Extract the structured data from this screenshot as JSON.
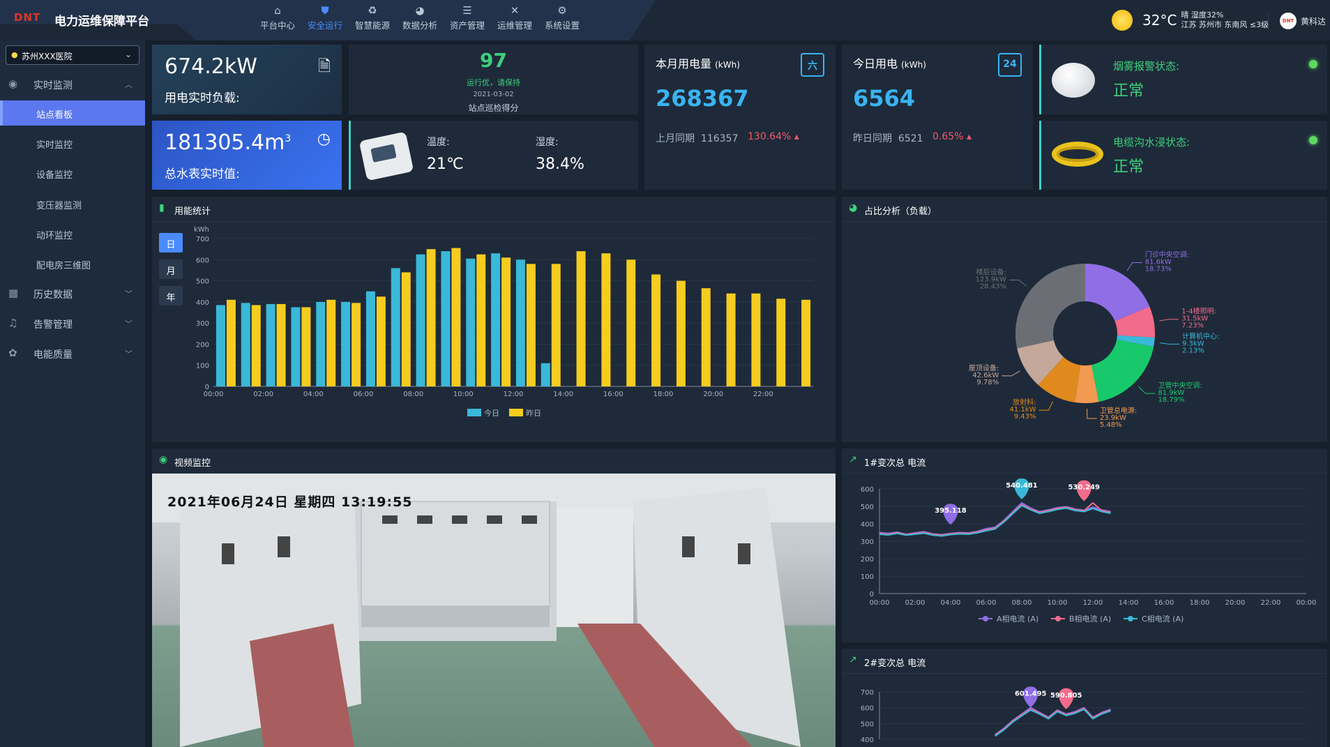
{
  "header": {
    "logo": "DNT",
    "title": "电力运维保障平台",
    "nav": [
      {
        "label": "平台中心",
        "icon": "home-icon"
      },
      {
        "label": "安全运行",
        "icon": "shield-icon"
      },
      {
        "label": "智慧能源",
        "icon": "recycle-icon"
      },
      {
        "label": "数据分析",
        "icon": "pie-icon"
      },
      {
        "label": "资产管理",
        "icon": "database-icon"
      },
      {
        "label": "运维管理",
        "icon": "tools-icon"
      },
      {
        "label": "系统设置",
        "icon": "gear-icon"
      }
    ],
    "active_nav": "安全运行",
    "weather": {
      "temp": "32°C",
      "line1": "晴 湿度32%",
      "line2": "江苏 苏州市 东南风 ≤3级"
    },
    "user": "黄科达"
  },
  "sidebar": {
    "site": "苏州XXX医院",
    "groups": [
      {
        "label": "实时监测",
        "icon": "monitor-icon",
        "expanded": true,
        "items": [
          "站点看板",
          "实时监控",
          "设备监控",
          "变压器监测",
          "动环监控",
          "配电房三维图"
        ],
        "active": "站点看板"
      },
      {
        "label": "历史数据",
        "icon": "calendar-icon"
      },
      {
        "label": "告警管理",
        "icon": "bell-icon"
      },
      {
        "label": "电能质量",
        "icon": "quality-icon"
      }
    ]
  },
  "cards": {
    "load": {
      "value": "674.2kW",
      "label": "用电实时负载:"
    },
    "water": {
      "value": "181305.4m",
      "sup": "3",
      "label": "总水表实时值:"
    },
    "score": {
      "value": "97",
      "status": "运行优，请保持",
      "date": "2021-03-02",
      "label": "站点巡检得分"
    },
    "env": {
      "temp_label": "温度:",
      "temp": "21℃",
      "hum_label": "湿度:",
      "hum": "38.4%"
    },
    "month": {
      "title": "本月用电量",
      "unit": "(kWh)",
      "value": "268367",
      "cmp_label": "上月同期",
      "cmp_value": "116357",
      "pct": "130.64%",
      "icon_text": "六"
    },
    "today": {
      "title": "今日用电",
      "unit": "(kWh)",
      "value": "6564",
      "cmp_label": "昨日同期",
      "cmp_value": "6521",
      "pct": "0.65%",
      "icon_text": "24"
    },
    "smoke": {
      "title": "烟雾报警状态:",
      "value": "正常"
    },
    "cable": {
      "title": "电缆沟水浸状态:",
      "value": "正常"
    }
  },
  "energy_panel": {
    "title": "用能统计",
    "periods": [
      "日",
      "月",
      "年"
    ],
    "active": "日"
  },
  "ratio_panel": {
    "title": "占比分析（负载）"
  },
  "video_panel": {
    "title": "视频监控",
    "osd": "2021年06月24日  星期四  13:19:55"
  },
  "cur1_panel": {
    "title": "1#变次总 电流"
  },
  "cur2_panel": {
    "title": "2#变次总 电流"
  },
  "chart_data": [
    {
      "type": "bar",
      "title": "用能统计",
      "ylabel": "kWh",
      "ylim": [
        0,
        700
      ],
      "yticks": [
        0,
        100,
        200,
        300,
        400,
        500,
        600,
        700
      ],
      "x_tick_labels": [
        "00:00",
        "02:00",
        "04:00",
        "06:00",
        "08:00",
        "10:00",
        "12:00",
        "14:00",
        "16:00",
        "18:00",
        "20:00",
        "22:00"
      ],
      "categories": [
        "00",
        "01",
        "02",
        "03",
        "04",
        "05",
        "06",
        "07",
        "08",
        "09",
        "10",
        "11",
        "12",
        "13",
        "14",
        "15",
        "16",
        "17",
        "18",
        "19",
        "20",
        "21",
        "22",
        "23"
      ],
      "series": [
        {
          "name": "今日",
          "color": "#3ab8d8",
          "values": [
            385,
            395,
            390,
            375,
            400,
            400,
            450,
            560,
            625,
            640,
            605,
            630,
            600,
            110,
            null,
            null,
            null,
            null,
            null,
            null,
            null,
            null,
            null,
            null
          ]
        },
        {
          "name": "昨日",
          "color": "#f5cc1f",
          "values": [
            410,
            385,
            390,
            375,
            410,
            395,
            425,
            540,
            650,
            655,
            625,
            610,
            580,
            580,
            640,
            630,
            600,
            530,
            500,
            465,
            440,
            440,
            415,
            410
          ]
        }
      ],
      "legend": "bottom"
    },
    {
      "type": "pie",
      "title": "占比分析（负载）",
      "donut": true,
      "slices": [
        {
          "name": "门诊中央空调",
          "value": 81.6,
          "unit": "kW",
          "pct": "18.73%",
          "color": "#8f6ee6"
        },
        {
          "name": "1-4楼照明",
          "value": 31.5,
          "unit": "kW",
          "pct": "7.23%",
          "color": "#f26b8a"
        },
        {
          "name": "计算机中心",
          "value": 9.3,
          "unit": "kW",
          "pct": "2.13%",
          "color": "#3ab8d8"
        },
        {
          "name": "卫管中央空调",
          "value": 81.9,
          "unit": "kW",
          "pct": "18.79%",
          "color": "#18c96b"
        },
        {
          "name": "卫管总电源",
          "value": 23.9,
          "unit": "kW",
          "pct": "5.48%",
          "color": "#f29a52"
        },
        {
          "name": "放射科",
          "value": 41.1,
          "unit": "kW",
          "pct": "9.43%",
          "color": "#e08a1e"
        },
        {
          "name": "屋顶设备",
          "value": 42.6,
          "unit": "kW",
          "pct": "9.78%",
          "color": "#c4a89a"
        },
        {
          "name": "楼层设备",
          "value": 123.9,
          "unit": "kW",
          "pct": "28.43%",
          "color": "#6b6f75"
        }
      ]
    },
    {
      "type": "line",
      "title": "1#变次总 电流",
      "ylim": [
        0,
        600
      ],
      "yticks": [
        0,
        100,
        200,
        300,
        400,
        500,
        600
      ],
      "x_tick_labels": [
        "00:00",
        "02:00",
        "04:00",
        "06:00",
        "08:00",
        "10:00",
        "12:00",
        "14:00",
        "16:00",
        "18:00",
        "20:00",
        "22:00",
        "00:00"
      ],
      "x_hours": [
        0,
        0.5,
        1,
        1.5,
        2,
        2.5,
        3,
        3.5,
        4,
        4.5,
        5,
        5.5,
        6,
        6.5,
        7,
        7.5,
        8,
        8.5,
        9,
        9.5,
        10,
        10.5,
        11,
        11.5,
        12,
        12.5,
        13
      ],
      "series": [
        {
          "name": "A相电流 (A)",
          "color": "#8f6ee6",
          "values": [
            350,
            345,
            352,
            340,
            348,
            355,
            342,
            338,
            345,
            350,
            348,
            356,
            372,
            380,
            420,
            470,
            520,
            490,
            470,
            480,
            492,
            498,
            485,
            478,
            495,
            480,
            470
          ]
        },
        {
          "name": "B相电流 (A)",
          "color": "#f26b8a",
          "values": [
            345,
            340,
            350,
            338,
            345,
            350,
            340,
            335,
            342,
            346,
            345,
            352,
            365,
            375,
            415,
            462,
            510,
            485,
            465,
            475,
            488,
            495,
            480,
            475,
            520,
            475,
            465
          ]
        },
        {
          "name": "C相电流 (A)",
          "color": "#3ab8d8",
          "values": [
            340,
            336,
            345,
            335,
            340,
            346,
            335,
            330,
            338,
            342,
            340,
            348,
            360,
            370,
            410,
            458,
            505,
            480,
            460,
            470,
            482,
            490,
            476,
            470,
            488,
            470,
            460
          ]
        }
      ],
      "markers": [
        {
          "label": "540.481",
          "x": 8,
          "y": 540.481,
          "color": "#3ab8d8"
        },
        {
          "label": "530.249",
          "x": 11.5,
          "y": 530.249,
          "color": "#f26b8a"
        },
        {
          "label": "395.118",
          "x": 4,
          "y": 395.118,
          "color": "#8f6ee6"
        }
      ],
      "legend": "bottom"
    },
    {
      "type": "line",
      "title": "2#变次总 电流",
      "ylim": [
        400,
        700
      ],
      "yticks": [
        400,
        500,
        600,
        700
      ],
      "x_hours": [
        6.5,
        7,
        7.5,
        8,
        8.5,
        9,
        9.5,
        10,
        10.5,
        11,
        11.5,
        12,
        12.5,
        13
      ],
      "series": [
        {
          "name": "A相电流 (A)",
          "color": "#8f6ee6",
          "values": [
            430,
            470,
            520,
            560,
            601,
            570,
            540,
            585,
            560,
            575,
            600,
            540,
            570,
            590
          ]
        },
        {
          "name": "B相电流 (A)",
          "color": "#f26b8a",
          "values": [
            425,
            465,
            515,
            555,
            590,
            565,
            535,
            580,
            555,
            570,
            595,
            535,
            565,
            585
          ]
        },
        {
          "name": "C相电流 (A)",
          "color": "#3ab8d8",
          "values": [
            420,
            460,
            510,
            548,
            585,
            560,
            530,
            575,
            550,
            565,
            590,
            530,
            560,
            580
          ]
        }
      ],
      "markers": [
        {
          "label": "601.495",
          "x": 8.5,
          "y": 601.495,
          "color": "#8f6ee6"
        },
        {
          "label": "590.805",
          "x": 10.5,
          "y": 590.805,
          "color": "#f26b8a"
        }
      ]
    }
  ]
}
